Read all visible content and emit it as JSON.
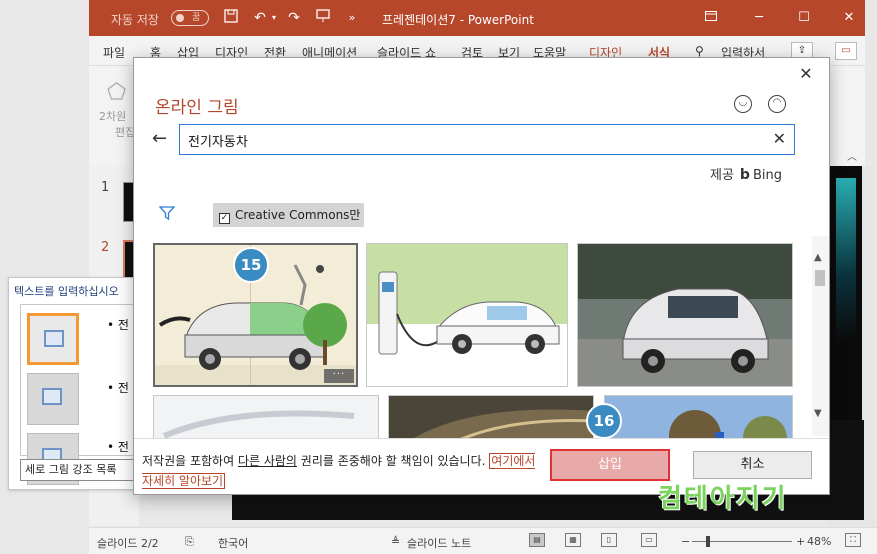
{
  "titlebar": {
    "autosave_label": "자동 저장",
    "autosave_state": "꿈",
    "doc_title": "프레젠테이션7  -  PowerPoint"
  },
  "ribbon": {
    "tabs": [
      "파일",
      "홈",
      "삽입",
      "디자인",
      "전환",
      "애니메이션",
      "슬라이드 쇼",
      "검토",
      "보기",
      "도움말",
      "디자인",
      "서식"
    ],
    "search_label": "입력하서",
    "group_label_1": "2차원",
    "group_label_2": "편집"
  },
  "slides": {
    "numbers": [
      "1",
      "2"
    ]
  },
  "text_pane": {
    "title": "텍스트를 입력하십시오",
    "bullets": [
      "• 전",
      "• 전",
      "• 전"
    ],
    "layout_name": "세로 그림 강조 목록"
  },
  "dialog": {
    "title": "온라인 그림",
    "search_value": "전기자동차",
    "provider_label": "제공",
    "provider_name": "Bing",
    "cc_filter_label": "Creative Commons만",
    "more_label": "···",
    "copyright_part1": "저작권을 포함하여 ",
    "copyright_part2": "다른 사람의",
    "copyright_part3": " 권리를 존중해야 할 책임이 있습니다. ",
    "learn_more": "여기에서 자세히 알아보기",
    "insert_label": "삽입",
    "cancel_label": "취소"
  },
  "badges": {
    "step_image": "15",
    "step_insert": "16"
  },
  "statusbar": {
    "slide_info": "슬라이드 2/2",
    "language": "한국어",
    "notes_label": "슬라이드 노트",
    "zoom": "48%"
  },
  "watermark": {
    "text": "컴테아지기"
  },
  "colors": {
    "accent": "#b7472a",
    "badge": "#3a8bc1",
    "insert_border": "#e03232"
  }
}
